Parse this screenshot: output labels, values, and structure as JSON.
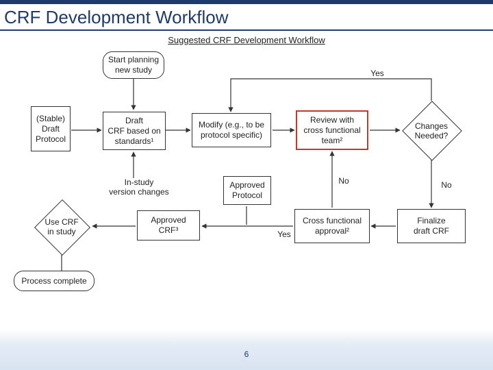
{
  "slide": {
    "title": "CRF Development Workflow",
    "subtitle": "Suggested CRF Development Workflow",
    "page_number": "6"
  },
  "nodes": {
    "start": "Start planning\nnew study",
    "stable_protocol": "(Stable)\nDraft\nProtocol",
    "draft_crf": "Draft\nCRF based on\nstandards¹",
    "modify": "Modify (e.g., to be\nprotocol specific)",
    "review": "Review with\ncross functional\nteam²",
    "changes_needed": "Changes\nNeeded?",
    "in_study_changes": "In-study\nversion changes",
    "approved_protocol": "Approved\nProtocol",
    "cross_approval": "Cross functional\napproval²",
    "finalize": "Finalize\ndraft CRF",
    "use_crf": "Use CRF\nin study",
    "approved_crf": "Approved\nCRF³",
    "process_complete": "Process complete"
  },
  "labels": {
    "yes_top": "Yes",
    "no_mid": "No",
    "no_right": "No",
    "yes_bottom": "Yes"
  }
}
